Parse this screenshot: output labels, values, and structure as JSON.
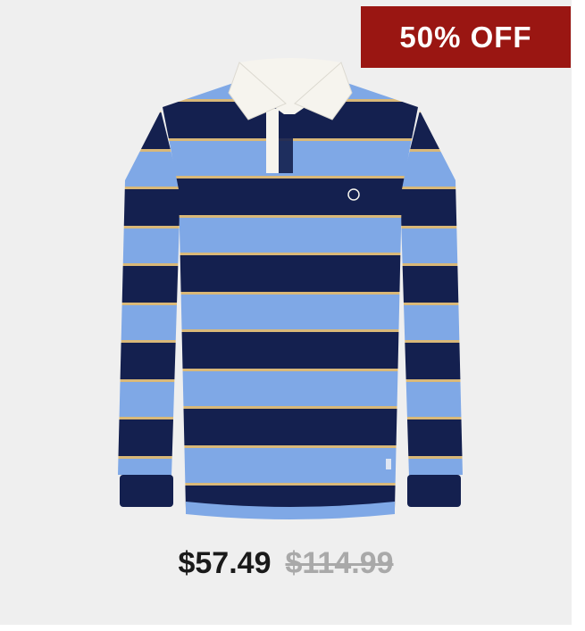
{
  "badge": {
    "text": "50% OFF",
    "color": "#9a1612"
  },
  "product": {
    "image": "striped-rugby-shirt",
    "colors": {
      "navy": "#14204f",
      "sky": "#7fa8e6",
      "gold": "#d9b878",
      "collar": "#f6f4ee"
    }
  },
  "price": {
    "current": "$57.49",
    "original": "$114.99"
  }
}
